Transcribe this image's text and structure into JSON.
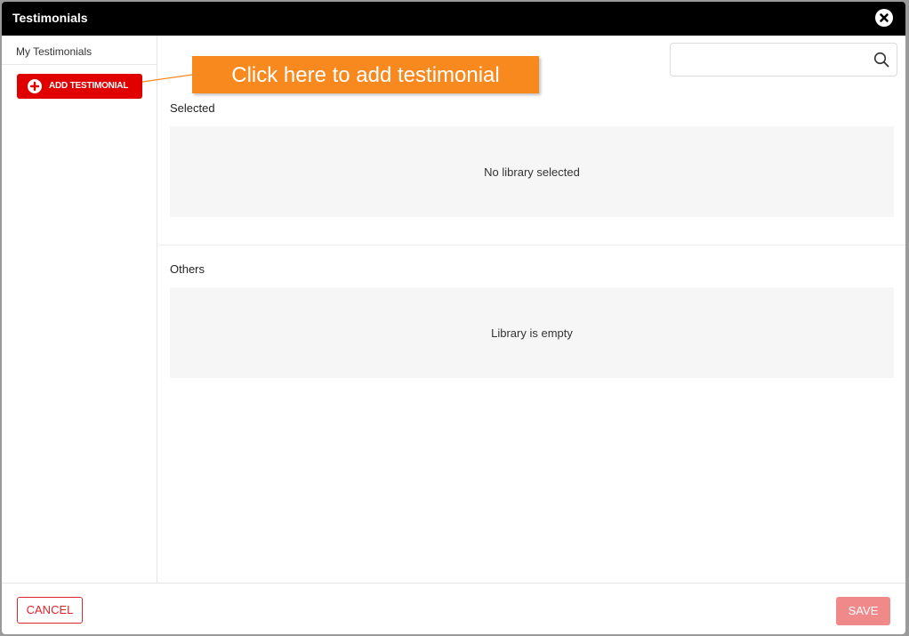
{
  "window": {
    "title": "Testimonials"
  },
  "sidebar": {
    "tab_label": "My Testimonials",
    "add_button_label": "ADD TESTIMONIAL"
  },
  "search": {
    "value": "",
    "placeholder": ""
  },
  "sections": {
    "selected": {
      "label": "Selected",
      "empty_text": "No library selected"
    },
    "others": {
      "label": "Others",
      "empty_text": "Library is empty"
    }
  },
  "footer": {
    "cancel_label": "CANCEL",
    "save_label": "SAVE"
  },
  "callout": {
    "text": "Click here to add testimonial"
  },
  "icons": {
    "close": "close-icon",
    "add": "plus-circle-icon",
    "search": "search-icon"
  },
  "colors": {
    "titlebar": "#000000",
    "primary_red": "#e00000",
    "cancel_red": "#d9262b",
    "save_disabled": "#f08a8a",
    "callout_orange": "#f7891f",
    "panel_bg": "#f6f6f6"
  }
}
